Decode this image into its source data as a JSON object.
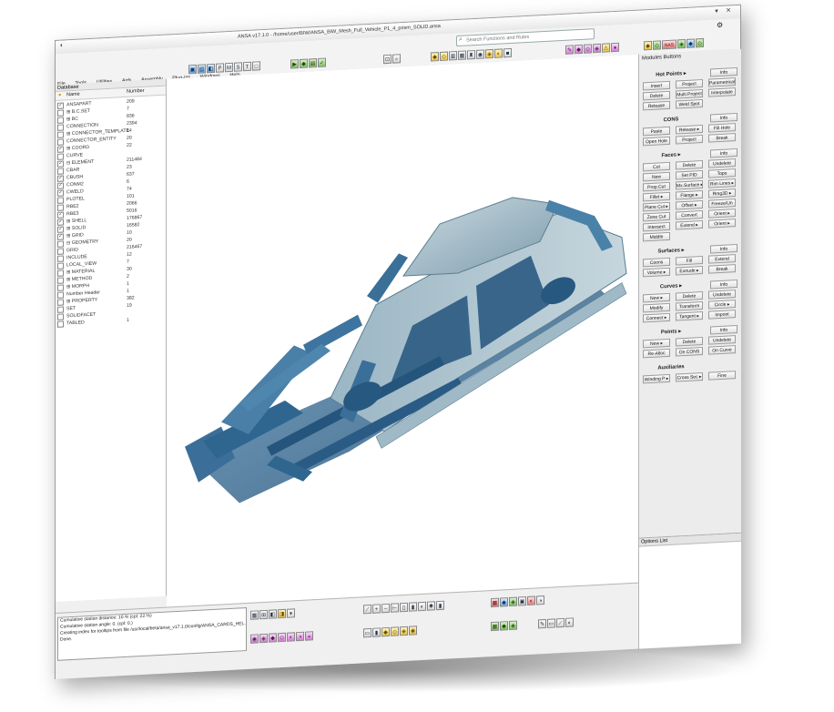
{
  "window": {
    "title": "ANSA v17.1.0 - /home/user/BIW/ANSA_BiW_Mesh_Full_Vehicle_P1_4_prism_SOLID.ansa",
    "corner_icon": "◐",
    "controls": [
      "▾",
      "✕"
    ],
    "gear": "⚙"
  },
  "search": {
    "placeholder": "Search Functions and Rules"
  },
  "menu": [
    "File",
    "Tools",
    "Utilities",
    "Aids",
    "Assembly",
    "Plug-ins",
    "Windows",
    "Help"
  ],
  "toolbars": {
    "view": [
      "▣",
      "▤",
      "◧",
      "P",
      "M",
      "S",
      "T",
      "□"
    ],
    "green": [
      "▶",
      "◆",
      "▤",
      "✓"
    ],
    "zoom": [
      "⊡",
      "⌕"
    ],
    "misc": [
      "◆",
      "◇",
      "▥",
      "▦",
      "♜",
      "◉",
      "◈",
      "◐",
      "■"
    ],
    "deck": [
      "✎",
      "◆",
      "◇",
      "◈",
      "⚠",
      "♦"
    ],
    "nastran_icons": [
      "◆",
      "◇",
      "NAS",
      "◈",
      "◆",
      "◇"
    ]
  },
  "database": {
    "header": "Database",
    "col_name": "Name",
    "col_number": "Number",
    "rows": [
      {
        "check": "✓",
        "name": "ANSAPART",
        "number": "209"
      },
      {
        "check": "",
        "name": "⊞ B.C.SET",
        "number": "7"
      },
      {
        "check": "",
        "name": "⊞ BC",
        "number": "836"
      },
      {
        "check": "",
        "name": "CONNECTION",
        "number": "2394"
      },
      {
        "check": "",
        "name": "⊞ CONNECTOR_TEMPLATE",
        "number": "14"
      },
      {
        "check": "",
        "name": "CONNECTOR_ENTITY",
        "number": "20"
      },
      {
        "check": "✓",
        "name": "⊞ COORD",
        "number": "22"
      },
      {
        "check": "",
        "name": "CURVE",
        "number": ""
      },
      {
        "check": "✓",
        "name": "⊟ ELEMENT",
        "number": "211484"
      },
      {
        "check": "",
        "name": "CBAR",
        "number": "23"
      },
      {
        "check": "✓",
        "name": "CBUSH",
        "number": "637"
      },
      {
        "check": "✓",
        "name": "CONM2",
        "number": "6"
      },
      {
        "check": "✓",
        "name": "CWELD",
        "number": "74"
      },
      {
        "check": "",
        "name": "PLOTEL",
        "number": "101"
      },
      {
        "check": "",
        "name": "RBE2",
        "number": "2066"
      },
      {
        "check": "✓",
        "name": "RBE3",
        "number": "5016"
      },
      {
        "check": "✓",
        "name": "⊞ SHELL",
        "number": "176867"
      },
      {
        "check": "✓",
        "name": "⊞ SOLID",
        "number": "16582"
      },
      {
        "check": "✓",
        "name": "⊞ GRID",
        "number": "10"
      },
      {
        "check": "",
        "name": "⊟ GEOMETRY",
        "number": "20"
      },
      {
        "check": "",
        "name": "GRID",
        "number": "216467"
      },
      {
        "check": "",
        "name": "INCLUDE",
        "number": "12"
      },
      {
        "check": "",
        "name": "LOCAL_VIEW",
        "number": "7"
      },
      {
        "check": "",
        "name": "⊞ MATERIAL",
        "number": "30"
      },
      {
        "check": "",
        "name": "⊞ METHOD",
        "number": "2"
      },
      {
        "check": "",
        "name": "⊞ MORPH",
        "number": "1"
      },
      {
        "check": "",
        "name": "Number Header",
        "number": "1"
      },
      {
        "check": "",
        "name": "⊞ PROPERTY",
        "number": "382"
      },
      {
        "check": "",
        "name": "SET",
        "number": "19"
      },
      {
        "check": "",
        "name": "SOLIDFACET",
        "number": ""
      },
      {
        "check": "",
        "name": "TABLED",
        "number": "1"
      }
    ]
  },
  "module_buttons": {
    "title": "Modules Buttons",
    "sections": [
      {
        "name": "Hot Points ▸",
        "info": "Info",
        "buttons": [
          "Insert",
          "Project",
          "Parametrical",
          "Delete",
          "Multi Project",
          "Interpolate",
          "Release",
          "Weld Spot"
        ]
      },
      {
        "name": "CONS",
        "info": "Info",
        "buttons": [
          "Paste",
          "Release ▸",
          "Fill Hole",
          "Open Hole",
          "Project",
          "Break"
        ]
      },
      {
        "name": "Faces ▸",
        "info": "Info",
        "buttons": [
          "Cut",
          "Delete",
          "Undelete",
          "New",
          "Set PID",
          "Topo",
          "Prop.Cut",
          "Mx.Surface ▸",
          "Rim Lines ▸",
          "Fillet ▸",
          "Flange ▸",
          "Rmg3D ▸",
          "Plane Cut ▸",
          "Offset ▸",
          "Freeze/Un",
          "Zone Cut",
          "Convert",
          "Orient ▸",
          "Intersect",
          "Extend ▸",
          "Orient ▸",
          "Middle"
        ]
      },
      {
        "name": "Surfaces ▸",
        "info": "Info",
        "buttons": [
          "Coons",
          "Fill",
          "Extend",
          "Volume ▸",
          "Extrude ▸",
          "Break"
        ]
      },
      {
        "name": "Curves ▸",
        "info": "Info",
        "buttons": [
          "New ▸",
          "Delete",
          "Undelete",
          "Modify",
          "Transform",
          "Circle ▸",
          "Connect ▸",
          "Tangent ▸",
          "Imprint"
        ]
      },
      {
        "name": "Points ▸",
        "info": "Info",
        "buttons": [
          "New ▸",
          "Delete",
          "Undelete",
          "Re-Alloc",
          "On CONS",
          "On Curve"
        ]
      },
      {
        "name": "Auxiliaries",
        "info": "",
        "buttons": [
          "Winding P ▸",
          "Cross Sec ▸",
          "Fine"
        ]
      }
    ]
  },
  "options_list": {
    "title": "Options List"
  },
  "console": {
    "lines": [
      "Cumulative station distance: 10.% (cpl: 22.%)",
      "Cumulative station angle: 0. (cpl: 0.)",
      "Creating index for tooltips from file /usr/local/beta/ansa_v17.1.0/config/ANSA_CARDS_HEL...",
      "Done."
    ]
  },
  "bottom_toolbars": {
    "row1a": [
      "▦",
      "⊞",
      "◧",
      "◨",
      "▾"
    ],
    "row1b": [
      "⟋",
      "+",
      "–",
      "⊢",
      "▯",
      "▮",
      "◐",
      "✱",
      "▮"
    ],
    "row1c": [
      "▦",
      "◆",
      "◈",
      "▣",
      "◐",
      "◑"
    ],
    "row2a": [
      "◉",
      "◈",
      "◆",
      "◇",
      "◐",
      "◑",
      "◒"
    ],
    "row2b": [
      "▭",
      "▮",
      "◆",
      "◇",
      "◈",
      "◉"
    ],
    "row2c": [
      "▦",
      "◆",
      "◈"
    ],
    "row2d": [
      "✎",
      "▭",
      "⟋",
      "◐"
    ]
  },
  "colors": {
    "accent": "#2f6fa6",
    "car_dark": "#2d5f88",
    "car_light": "#9fb9c6"
  }
}
